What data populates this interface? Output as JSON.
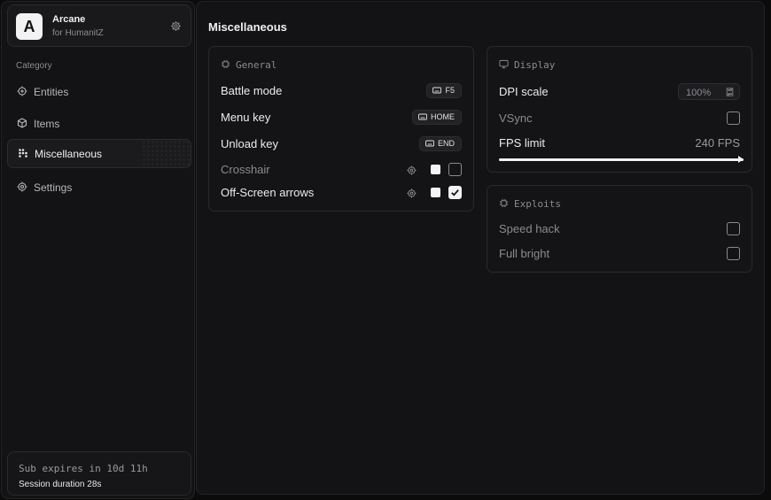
{
  "brand": {
    "name": "Arcane",
    "subtitle": "for HumanitZ",
    "logo_letter": "A"
  },
  "sidebar": {
    "category_label": "Category",
    "items": [
      {
        "label": "Entities",
        "icon": "target-icon",
        "active": false
      },
      {
        "label": "Items",
        "icon": "cube-icon",
        "active": false
      },
      {
        "label": "Miscellaneous",
        "icon": "grid-dots-icon",
        "active": true
      },
      {
        "label": "Settings",
        "icon": "gear-icon",
        "active": false
      }
    ]
  },
  "status": {
    "subscription": "Sub expires in 10d 11h",
    "session": "Session duration 28s"
  },
  "main": {
    "title": "Miscellaneous"
  },
  "general": {
    "header": "General",
    "battle_mode": {
      "label": "Battle mode",
      "key": "F5"
    },
    "menu_key": {
      "label": "Menu key",
      "key": "HOME"
    },
    "unload_key": {
      "label": "Unload key",
      "key": "END"
    },
    "crosshair": {
      "label": "Crosshair",
      "enabled": false,
      "color": "#ffffff"
    },
    "offscreen": {
      "label": "Off-Screen arrows",
      "enabled": true,
      "color": "#ffffff"
    }
  },
  "display": {
    "header": "Display",
    "dpi": {
      "label": "DPI scale",
      "value": "100%"
    },
    "vsync": {
      "label": "VSync",
      "enabled": false
    },
    "fps": {
      "label": "FPS limit",
      "value": "240 FPS",
      "fill": 1.0
    }
  },
  "exploits": {
    "header": "Exploits",
    "speed_hack": {
      "label": "Speed hack",
      "enabled": false
    },
    "full_bright": {
      "label": "Full bright",
      "enabled": false
    }
  },
  "colors": {
    "accent": "#f2f2f2",
    "panel": "#131315",
    "border": "#2a2a2d",
    "muted": "#8b8b90"
  }
}
